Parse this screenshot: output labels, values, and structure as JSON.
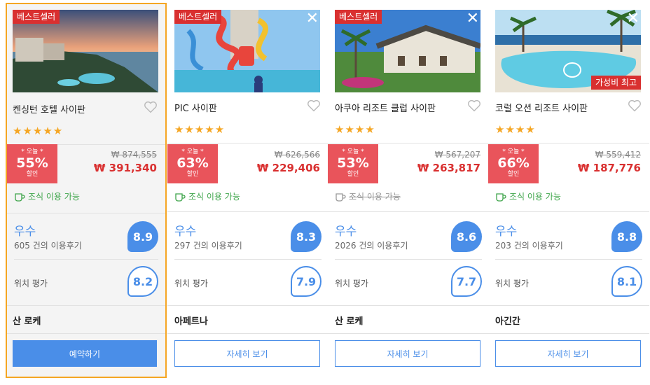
{
  "hotels": [
    {
      "best_badge": "베스트셀러",
      "value_badge": "",
      "name": "켄싱턴 호텔 사이판",
      "stars": "★★★★★",
      "today_label": "* 오늘 *",
      "discount": "55%",
      "sale_label": "할인",
      "original_price": "₩ 874,555",
      "price": "₩ 391,340",
      "breakfast": "조식 이용 가능",
      "breakfast_available": true,
      "rating_word": "우수",
      "reviews": "605 건의 이용후기",
      "score": "8.9",
      "location_label": "위치 평가",
      "location_score": "8.2",
      "area": "산 로케",
      "button": "예약하기",
      "selected": true,
      "closable": false
    },
    {
      "best_badge": "베스트셀러",
      "value_badge": "",
      "name": "PIC 사이판",
      "stars": "★★★★★",
      "today_label": "* 오늘 *",
      "discount": "63%",
      "sale_label": "할인",
      "original_price": "₩ 626,566",
      "price": "₩ 229,406",
      "breakfast": "조식 이용 가능",
      "breakfast_available": true,
      "rating_word": "우수",
      "reviews": "297 건의 이용후기",
      "score": "8.3",
      "location_label": "위치 평가",
      "location_score": "7.9",
      "area": "아페트나",
      "button": "자세히 보기",
      "selected": false,
      "closable": true
    },
    {
      "best_badge": "베스트셀러",
      "value_badge": "",
      "name": "아쿠아 리조트 클럽 사이판",
      "stars": "★★★★",
      "today_label": "* 오늘 *",
      "discount": "53%",
      "sale_label": "할인",
      "original_price": "₩ 567,207",
      "price": "₩ 263,817",
      "breakfast": "조식 이용 가능",
      "breakfast_available": false,
      "rating_word": "우수",
      "reviews": "2026 건의 이용후기",
      "score": "8.6",
      "location_label": "위치 평가",
      "location_score": "7.7",
      "area": "산 로케",
      "button": "자세히 보기",
      "selected": false,
      "closable": true
    },
    {
      "best_badge": "",
      "value_badge": "가성비 최고",
      "name": "코럴 오션 리조트 사이판",
      "stars": "★★★★",
      "today_label": "* 오늘 *",
      "discount": "66%",
      "sale_label": "할인",
      "original_price": "₩ 559,412",
      "price": "₩ 187,776",
      "breakfast": "조식 이용 가능",
      "breakfast_available": true,
      "rating_word": "우수",
      "reviews": "203 건의 이용후기",
      "score": "8.8",
      "location_label": "위치 평가",
      "location_score": "8.1",
      "area": "아긴간",
      "button": "자세히 보기",
      "selected": false,
      "closable": true
    }
  ],
  "colors": {
    "accent": "#4a8ee8",
    "sale_red": "#e9545b",
    "price_red": "#d93030",
    "highlight_border": "#f5a623",
    "breakfast_green": "#3ea54a"
  },
  "icons": {
    "heart": "heart-outline-icon",
    "cup": "coffee-cup-icon",
    "close": "close-icon"
  }
}
